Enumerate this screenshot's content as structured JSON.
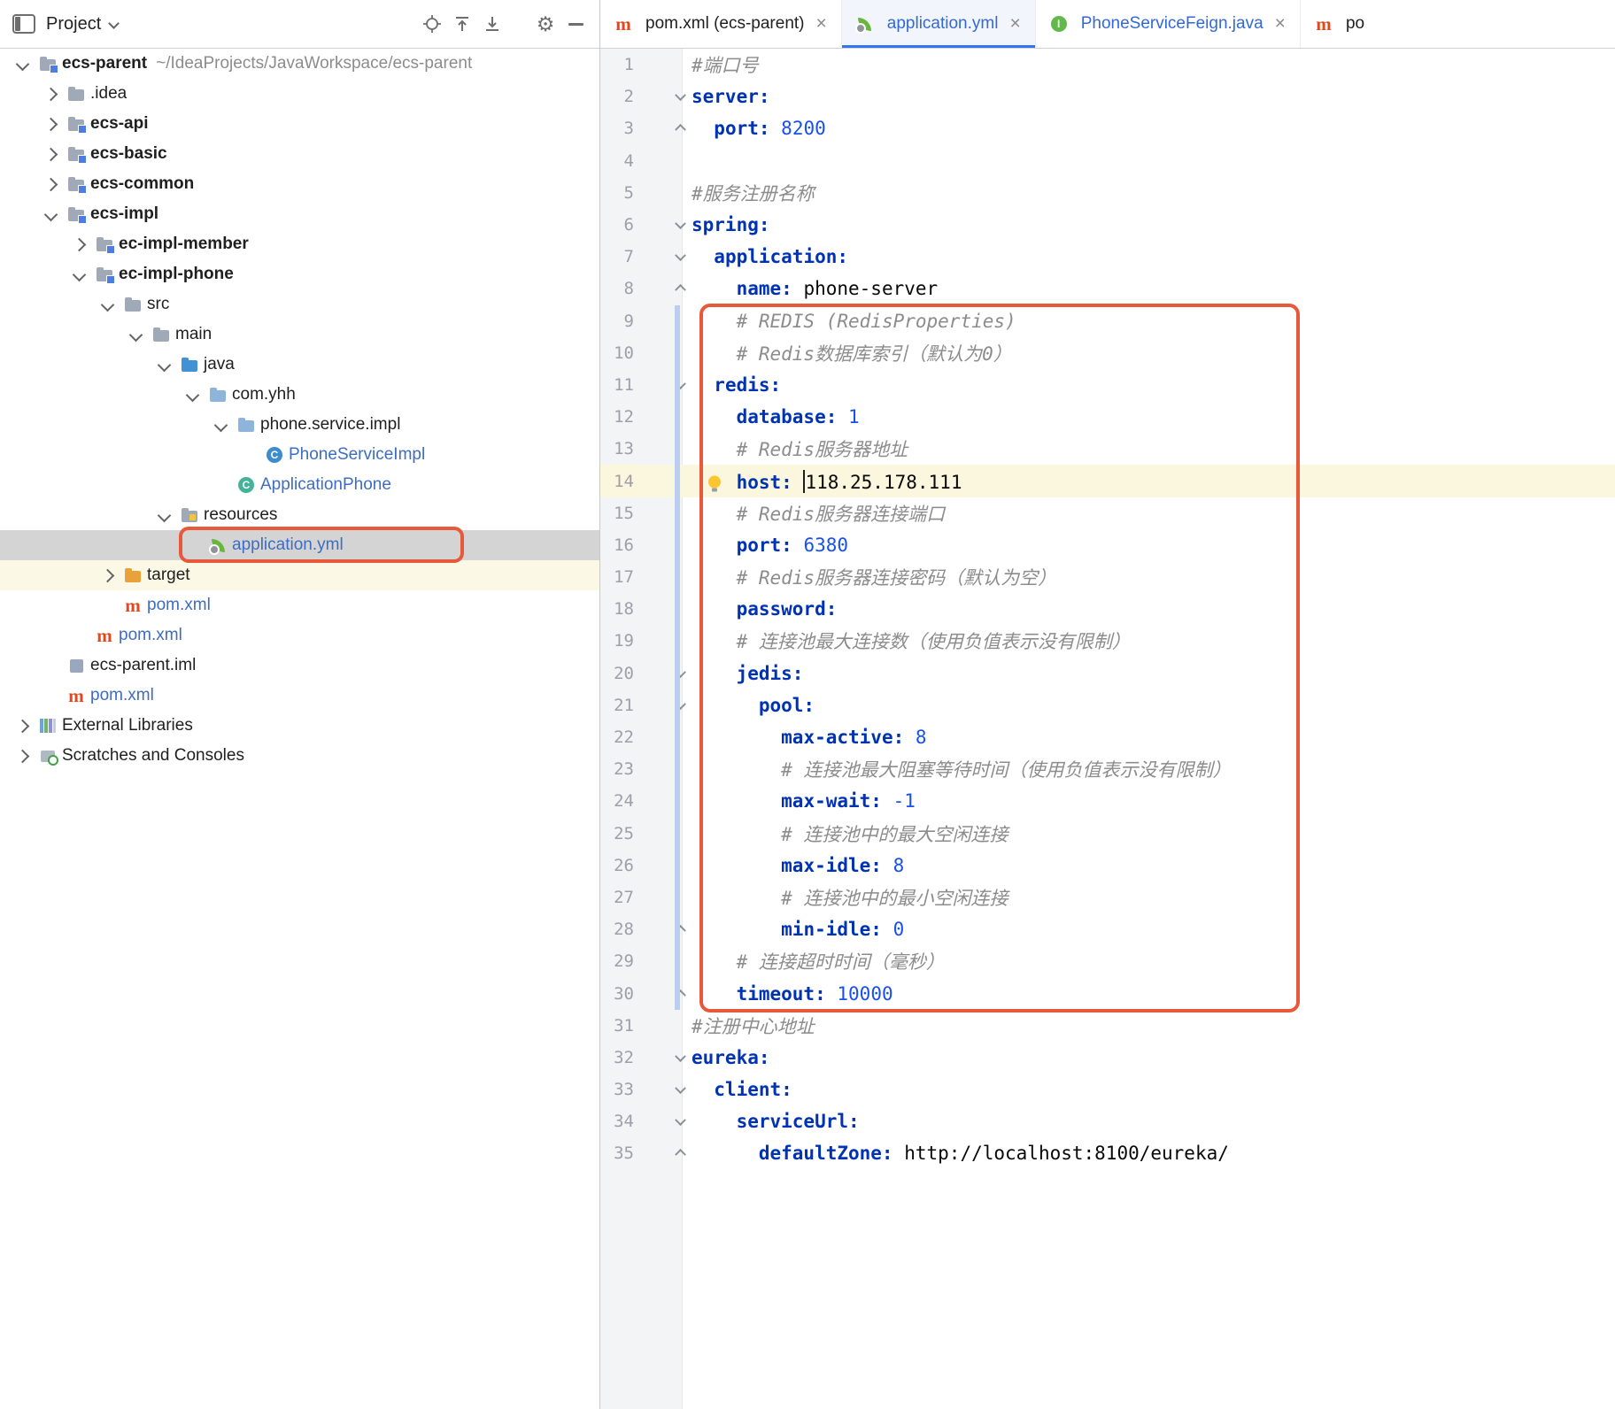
{
  "colors": {
    "accent_blue": "#3574F0",
    "yaml_key": "#0033B3",
    "yaml_number": "#1750EB",
    "comment_gray": "#8C8C8C",
    "modified_file_blue": "#3D6CC2",
    "annotation_orange": "#E8593C",
    "selected_row_gray": "#D4D4D4",
    "current_line_yellow": "#FBF6DE",
    "gutter_gray": "#F3F4F5",
    "vcs_change_bar_blue": "#BCCDF2"
  },
  "project_panel": {
    "title": "Project",
    "header_icons": [
      "panel-icon",
      "chevron-down-icon",
      "locate-icon",
      "collapse-all-icon",
      "expand-all-icon",
      "settings-icon",
      "hide-panel-icon"
    ],
    "tree": [
      {
        "label": "ecs-parent",
        "annotation": "~/IdeaProjects/JavaWorkspace/ecs-parent",
        "level": 0,
        "chevron": "expanded",
        "icon": "module-folder",
        "bold": true
      },
      {
        "label": ".idea",
        "level": 1,
        "chevron": "collapsed",
        "icon": "folder"
      },
      {
        "label": "ecs-api",
        "level": 1,
        "chevron": "collapsed",
        "icon": "module-folder",
        "bold": true
      },
      {
        "label": "ecs-basic",
        "level": 1,
        "chevron": "collapsed",
        "icon": "module-folder",
        "bold": true
      },
      {
        "label": "ecs-common",
        "level": 1,
        "chevron": "collapsed",
        "icon": "module-folder",
        "bold": true
      },
      {
        "label": "ecs-impl",
        "level": 1,
        "chevron": "expanded",
        "icon": "module-folder",
        "bold": true
      },
      {
        "label": "ec-impl-member",
        "level": 2,
        "chevron": "collapsed",
        "icon": "module-folder",
        "bold": true
      },
      {
        "label": "ec-impl-phone",
        "level": 2,
        "chevron": "expanded",
        "icon": "module-folder",
        "bold": true
      },
      {
        "label": "src",
        "level": 3,
        "chevron": "expanded",
        "icon": "folder"
      },
      {
        "label": "main",
        "level": 4,
        "chevron": "expanded",
        "icon": "folder"
      },
      {
        "label": "java",
        "level": 5,
        "chevron": "expanded",
        "icon": "source-folder"
      },
      {
        "label": "com.yhh",
        "level": 6,
        "chevron": "expanded",
        "icon": "package"
      },
      {
        "label": "phone.service.impl",
        "level": 7,
        "chevron": "expanded",
        "icon": "package"
      },
      {
        "label": "PhoneServiceImpl",
        "level": 8,
        "icon": "class",
        "blue": true
      },
      {
        "label": "ApplicationPhone",
        "level": 7,
        "icon": "boot-class",
        "blue": true
      },
      {
        "label": "resources",
        "level": 5,
        "chevron": "expanded",
        "icon": "resources-folder"
      },
      {
        "label": "application.yml",
        "level": 6,
        "icon": "spring",
        "blue": true,
        "selected": true,
        "orange_box": true
      },
      {
        "label": "target",
        "level": 3,
        "chevron": "collapsed",
        "icon": "excluded-folder",
        "tint": true
      },
      {
        "label": "pom.xml",
        "level": 3,
        "icon": "maven",
        "blue": true
      },
      {
        "label": "pom.xml",
        "level": 2,
        "icon": "maven",
        "blue": true
      },
      {
        "label": "ecs-parent.iml",
        "level": 1,
        "icon": "iml"
      },
      {
        "label": "pom.xml",
        "level": 1,
        "icon": "maven",
        "blue": true
      },
      {
        "label": "External Libraries",
        "level": 0,
        "chevron": "collapsed",
        "icon": "libraries"
      },
      {
        "label": "Scratches and Consoles",
        "level": 0,
        "chevron": "collapsed",
        "icon": "scratches"
      }
    ]
  },
  "tabs": [
    {
      "label": "pom.xml (ecs-parent)",
      "icon": "maven",
      "active": false,
      "blue": false
    },
    {
      "label": "application.yml",
      "icon": "spring",
      "active": true,
      "blue": true
    },
    {
      "label": "PhoneServiceFeign.java",
      "icon": "interface",
      "active": false,
      "blue": true
    },
    {
      "label": "po",
      "icon": "maven",
      "active": false,
      "blue": false,
      "partial": true
    }
  ],
  "editor": {
    "current_line": 14,
    "changed_lines": {
      "from": 9,
      "to": 30
    },
    "annotation_lines": {
      "from": 9,
      "to": 30
    },
    "lines": [
      {
        "n": 1,
        "tokens": [
          [
            "com",
            "#端口号"
          ]
        ]
      },
      {
        "n": 2,
        "tokens": [
          [
            "key",
            "server:"
          ]
        ],
        "fold": "down"
      },
      {
        "n": 3,
        "tokens": [
          [
            "sp",
            "  "
          ],
          [
            "key",
            "port:"
          ],
          [
            "sp",
            " "
          ],
          [
            "num",
            "8200"
          ]
        ],
        "fold": "up"
      },
      {
        "n": 4,
        "tokens": []
      },
      {
        "n": 5,
        "tokens": [
          [
            "com",
            "#服务注册名称"
          ]
        ]
      },
      {
        "n": 6,
        "tokens": [
          [
            "key",
            "spring:"
          ]
        ],
        "fold": "down"
      },
      {
        "n": 7,
        "tokens": [
          [
            "sp",
            "  "
          ],
          [
            "key",
            "application:"
          ]
        ],
        "fold": "down"
      },
      {
        "n": 8,
        "tokens": [
          [
            "sp",
            "    "
          ],
          [
            "key",
            "name:"
          ],
          [
            "sp",
            " "
          ],
          [
            "str",
            "phone-server"
          ]
        ],
        "fold": "up"
      },
      {
        "n": 9,
        "tokens": [
          [
            "sp",
            "    "
          ],
          [
            "com",
            "# REDIS (RedisProperties)"
          ]
        ]
      },
      {
        "n": 10,
        "tokens": [
          [
            "sp",
            "    "
          ],
          [
            "com",
            "# Redis数据库索引（默认为0）"
          ]
        ]
      },
      {
        "n": 11,
        "tokens": [
          [
            "sp",
            "  "
          ],
          [
            "key",
            "redis:"
          ]
        ],
        "fold": "down"
      },
      {
        "n": 12,
        "tokens": [
          [
            "sp",
            "    "
          ],
          [
            "key",
            "database:"
          ],
          [
            "sp",
            " "
          ],
          [
            "num",
            "1"
          ]
        ]
      },
      {
        "n": 13,
        "tokens": [
          [
            "sp",
            "    "
          ],
          [
            "com",
            "# Redis服务器地址"
          ]
        ]
      },
      {
        "n": 14,
        "tokens": [
          [
            "sp",
            "    "
          ],
          [
            "key",
            "host:"
          ],
          [
            "sp",
            " "
          ],
          [
            "caret",
            ""
          ],
          [
            "str",
            "118.25.178.111"
          ]
        ],
        "bulb": true
      },
      {
        "n": 15,
        "tokens": [
          [
            "sp",
            "    "
          ],
          [
            "com",
            "# Redis服务器连接端口"
          ]
        ]
      },
      {
        "n": 16,
        "tokens": [
          [
            "sp",
            "    "
          ],
          [
            "key",
            "port:"
          ],
          [
            "sp",
            " "
          ],
          [
            "num",
            "6380"
          ]
        ]
      },
      {
        "n": 17,
        "tokens": [
          [
            "sp",
            "    "
          ],
          [
            "com",
            "# Redis服务器连接密码（默认为空）"
          ]
        ]
      },
      {
        "n": 18,
        "tokens": [
          [
            "sp",
            "    "
          ],
          [
            "key",
            "password:"
          ]
        ]
      },
      {
        "n": 19,
        "tokens": [
          [
            "sp",
            "    "
          ],
          [
            "com",
            "# 连接池最大连接数（使用负值表示没有限制）"
          ]
        ]
      },
      {
        "n": 20,
        "tokens": [
          [
            "sp",
            "    "
          ],
          [
            "key",
            "jedis:"
          ]
        ],
        "fold": "down"
      },
      {
        "n": 21,
        "tokens": [
          [
            "sp",
            "      "
          ],
          [
            "key",
            "pool:"
          ]
        ],
        "fold": "down"
      },
      {
        "n": 22,
        "tokens": [
          [
            "sp",
            "        "
          ],
          [
            "key",
            "max-active:"
          ],
          [
            "sp",
            " "
          ],
          [
            "num",
            "8"
          ]
        ]
      },
      {
        "n": 23,
        "tokens": [
          [
            "sp",
            "        "
          ],
          [
            "com",
            "# 连接池最大阻塞等待时间（使用负值表示没有限制）"
          ]
        ]
      },
      {
        "n": 24,
        "tokens": [
          [
            "sp",
            "        "
          ],
          [
            "key",
            "max-wait:"
          ],
          [
            "sp",
            " "
          ],
          [
            "num",
            "-1"
          ]
        ]
      },
      {
        "n": 25,
        "tokens": [
          [
            "sp",
            "        "
          ],
          [
            "com",
            "# 连接池中的最大空闲连接"
          ]
        ]
      },
      {
        "n": 26,
        "tokens": [
          [
            "sp",
            "        "
          ],
          [
            "key",
            "max-idle:"
          ],
          [
            "sp",
            " "
          ],
          [
            "num",
            "8"
          ]
        ]
      },
      {
        "n": 27,
        "tokens": [
          [
            "sp",
            "        "
          ],
          [
            "com",
            "# 连接池中的最小空闲连接"
          ]
        ]
      },
      {
        "n": 28,
        "tokens": [
          [
            "sp",
            "        "
          ],
          [
            "key",
            "min-idle:"
          ],
          [
            "sp",
            " "
          ],
          [
            "num",
            "0"
          ]
        ],
        "fold": "up"
      },
      {
        "n": 29,
        "tokens": [
          [
            "sp",
            "    "
          ],
          [
            "com",
            "# 连接超时时间（毫秒）"
          ]
        ]
      },
      {
        "n": 30,
        "tokens": [
          [
            "sp",
            "    "
          ],
          [
            "key",
            "timeout:"
          ],
          [
            "sp",
            " "
          ],
          [
            "num",
            "10000"
          ]
        ],
        "fold": "up"
      },
      {
        "n": 31,
        "tokens": [
          [
            "com",
            "#注册中心地址"
          ]
        ]
      },
      {
        "n": 32,
        "tokens": [
          [
            "key",
            "eureka:"
          ]
        ],
        "fold": "down"
      },
      {
        "n": 33,
        "tokens": [
          [
            "sp",
            "  "
          ],
          [
            "key",
            "client:"
          ]
        ],
        "fold": "down"
      },
      {
        "n": 34,
        "tokens": [
          [
            "sp",
            "    "
          ],
          [
            "key",
            "serviceUrl:"
          ]
        ],
        "fold": "down"
      },
      {
        "n": 35,
        "tokens": [
          [
            "sp",
            "      "
          ],
          [
            "key",
            "defaultZone:"
          ],
          [
            "sp",
            " "
          ],
          [
            "str",
            "http://localhost:8100/eureka/"
          ]
        ],
        "fold": "up"
      }
    ]
  }
}
